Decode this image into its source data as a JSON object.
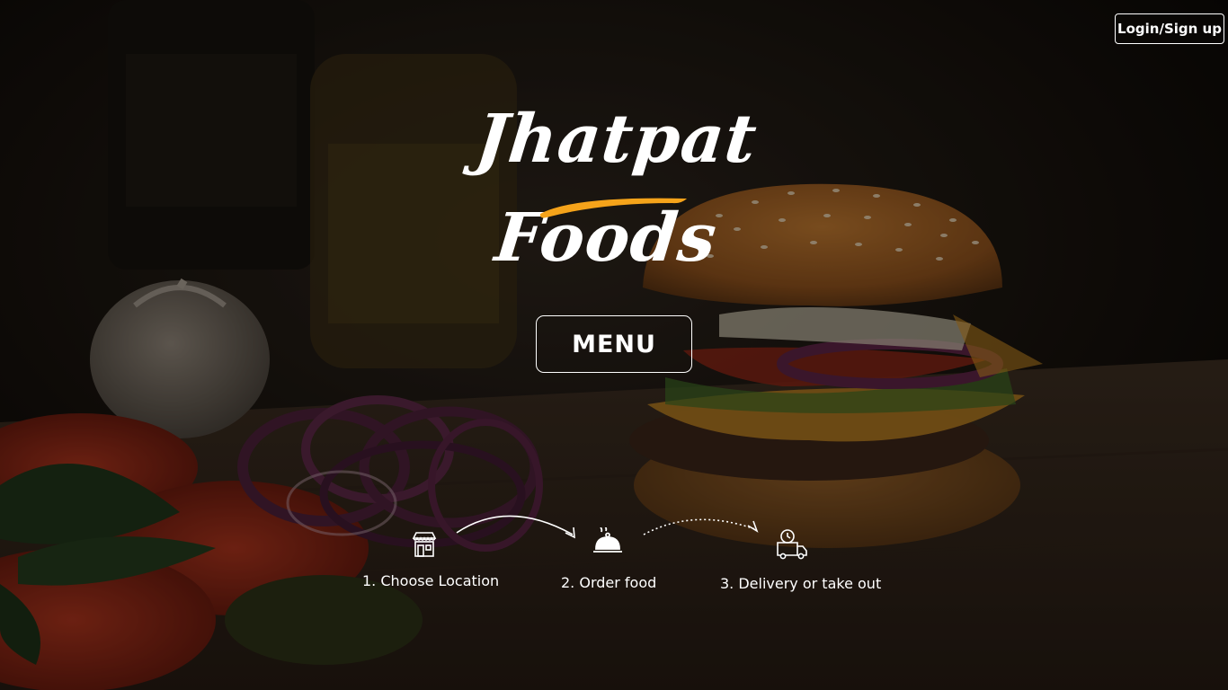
{
  "header": {
    "login_label": "Login/Sign up"
  },
  "brand": {
    "title": "Jhatpat Foods",
    "accent_color": "#f5a31a"
  },
  "menu": {
    "label": "MENU"
  },
  "steps": [
    {
      "label": "1. Choose Location",
      "icon": "store-icon"
    },
    {
      "label": "2. Order food",
      "icon": "cloche-icon"
    },
    {
      "label": "3. Delivery or take out",
      "icon": "delivery-truck-icon"
    }
  ],
  "background": {
    "subject": "burger-photo"
  }
}
